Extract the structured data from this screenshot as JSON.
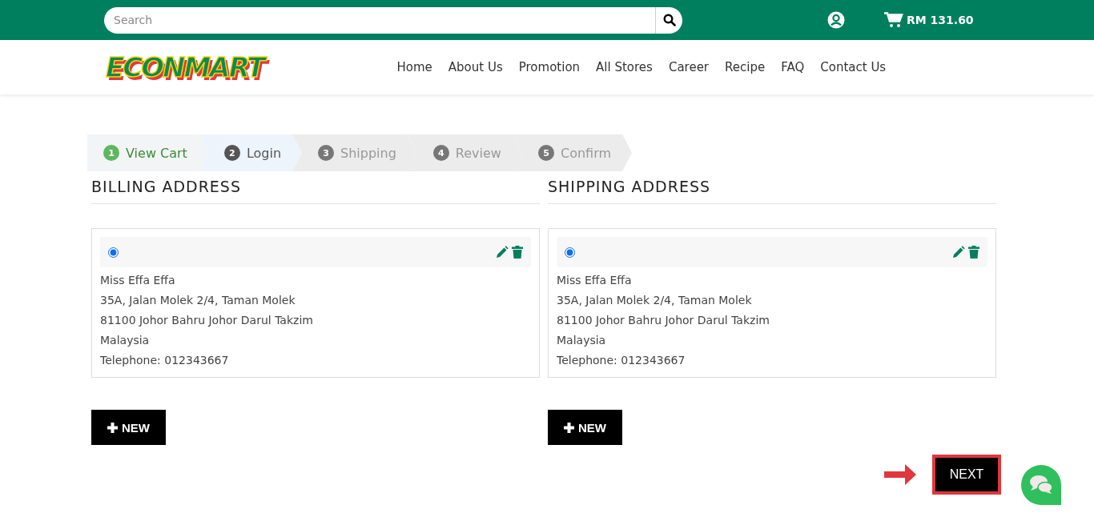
{
  "topbar": {
    "search": {
      "placeholder": "Search"
    },
    "cart_total": "RM 131.60"
  },
  "logo": "ECONMART",
  "nav": [
    "Home",
    "About Us",
    "Promotion",
    "All Stores",
    "Career",
    "Recipe",
    "FAQ",
    "Contact Us"
  ],
  "steps": [
    {
      "number": "1",
      "label": "View Cart",
      "kind": "done"
    },
    {
      "number": "2",
      "label": "Login",
      "kind": "current"
    },
    {
      "number": "3",
      "label": "Shipping",
      "kind": "pending"
    },
    {
      "number": "4",
      "label": "Review",
      "kind": "pending"
    },
    {
      "number": "5",
      "label": "Confirm",
      "kind": "pending"
    }
  ],
  "sections": [
    {
      "title": "BILLING ADDRESS",
      "addresses": [
        {
          "selected": true,
          "lines": [
            "Miss Effa Effa",
            "35A, Jalan Molek 2/4, Taman Molek",
            "81100 Johor Bahru Johor Darul Takzim",
            "Malaysia",
            "Telephone: 012343667"
          ]
        }
      ],
      "new_button": "NEW"
    },
    {
      "title": "SHIPPING ADDRESS",
      "addresses": [
        {
          "selected": true,
          "lines": [
            "Miss Effa Effa",
            "35A, Jalan Molek 2/4, Taman Molek",
            "81100 Johor Bahru Johor Darul Takzim",
            "Malaysia",
            "Telephone: 012343667"
          ]
        }
      ],
      "new_button": "NEW"
    }
  ],
  "next_button": "NEXT"
}
